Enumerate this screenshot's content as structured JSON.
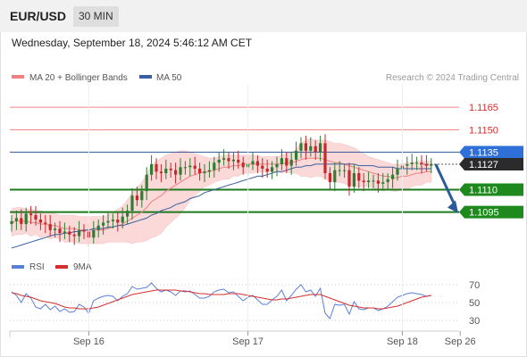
{
  "header": {
    "pair": "EUR/USD",
    "timeframe": "30 MIN",
    "timestamp": "Wednesday, September 18, 2024 5:46:12 AM CET"
  },
  "colors": {
    "ma20": "#f08080",
    "ma50": "#3a5fa0",
    "band": "#fbd9d9",
    "up": "#2e7d32",
    "down": "#c62828",
    "support": "#1e7a1e",
    "resistance": "#f08080",
    "level_blue": "#3a5fa0",
    "current": "#2b2b2b",
    "arrow": "#2a5a9a",
    "rsi": "#5b7fd9",
    "rsi_ma": "#d32f2f"
  },
  "legend": {
    "ma20_label": "MA 20 + Bollinger Bands",
    "ma50_label": "MA 50",
    "source": "Research © 2024 Trading Central"
  },
  "rsi_legend": {
    "rsi_label": "RSI",
    "ma_label": "9MA"
  },
  "chart_data": {
    "type": "candlestick",
    "ylim": [
      1.1065,
      1.118
    ],
    "levels": [
      {
        "price": 1.1165,
        "label": "1.1165",
        "kind": "resistance"
      },
      {
        "price": 1.115,
        "label": "1.1150",
        "kind": "resistance"
      },
      {
        "price": 1.1135,
        "label": "1.1135",
        "kind": "pivot"
      },
      {
        "price": 1.1127,
        "label": "1.1127",
        "kind": "current"
      },
      {
        "price": 1.111,
        "label": "1.1110",
        "kind": "support"
      },
      {
        "price": 1.1095,
        "label": "1.1095",
        "kind": "support"
      }
    ],
    "close": [
      1.1089,
      1.1091,
      1.1087,
      1.1094,
      1.1093,
      1.109,
      1.1088,
      1.1087,
      1.1083,
      1.1084,
      1.1081,
      1.1082,
      1.108,
      1.1079,
      1.1083,
      1.1082,
      1.1078,
      1.1083,
      1.1086,
      1.1088,
      1.1089,
      1.109,
      1.1088,
      1.1092,
      1.1096,
      1.1106,
      1.1103,
      1.1109,
      1.112,
      1.1127,
      1.1122,
      1.1121,
      1.1124,
      1.1123,
      1.112,
      1.1125,
      1.1125,
      1.1126,
      1.1124,
      1.1121,
      1.1122,
      1.1123,
      1.1128,
      1.113,
      1.1131,
      1.1129,
      1.113,
      1.1128,
      1.1125,
      1.1127,
      1.1129,
      1.1126,
      1.1124,
      1.1122,
      1.1125,
      1.1127,
      1.1131,
      1.1126,
      1.113,
      1.1136,
      1.1141,
      1.1136,
      1.1139,
      1.1135,
      1.1141,
      1.1121,
      1.1115,
      1.1123,
      1.1123,
      1.1123,
      1.1112,
      1.1121,
      1.1116,
      1.1115,
      1.1116,
      1.1116,
      1.1114,
      1.1115,
      1.1117,
      1.112,
      1.1124,
      1.1126,
      1.1127,
      1.1128,
      1.1128,
      1.1127,
      1.1126,
      1.1127
    ],
    "ma20": [
      1.1088,
      1.1089,
      1.1089,
      1.1089,
      1.1088,
      1.1088,
      1.1087,
      1.1087,
      1.1086,
      1.1086,
      1.1085,
      1.1084,
      1.1084,
      1.1084,
      1.1083,
      1.1083,
      1.1083,
      1.1083,
      1.1083,
      1.1083,
      1.1084,
      1.1085,
      1.1086,
      1.1087,
      1.1089,
      1.1091,
      1.1093,
      1.1095,
      1.1098,
      1.1102,
      1.1104,
      1.1106,
      1.1109,
      1.1111,
      1.1113,
      1.1115,
      1.1117,
      1.1119,
      1.112,
      1.1121,
      1.1122,
      1.1122,
      1.1123,
      1.1124,
      1.1125,
      1.1125,
      1.1126,
      1.1126,
      1.1127,
      1.1127,
      1.1127,
      1.1127,
      1.1127,
      1.1127,
      1.1127,
      1.1127,
      1.1127,
      1.1128,
      1.1128,
      1.1129,
      1.113,
      1.1131,
      1.1131,
      1.1131,
      1.1131,
      1.113,
      1.1129,
      1.1128,
      1.1128,
      1.1127,
      1.1126,
      1.1125,
      1.1124,
      1.1123,
      1.1122,
      1.1121,
      1.112,
      1.1119,
      1.1119,
      1.1118,
      1.1118,
      1.1119,
      1.1119,
      1.112,
      1.1121,
      1.1121,
      1.1122,
      1.1122
    ],
    "upper_band": [
      1.1097,
      1.1098,
      1.1098,
      1.1097,
      1.1097,
      1.1096,
      1.1096,
      1.1095,
      1.1095,
      1.1094,
      1.1093,
      1.1093,
      1.1093,
      1.1093,
      1.1092,
      1.1092,
      1.1092,
      1.1092,
      1.1092,
      1.1092,
      1.1093,
      1.1095,
      1.1097,
      1.1099,
      1.1103,
      1.1108,
      1.1111,
      1.1115,
      1.112,
      1.1126,
      1.1129,
      1.1131,
      1.1133,
      1.1134,
      1.1135,
      1.1136,
      1.1136,
      1.1135,
      1.1134,
      1.1133,
      1.1132,
      1.1131,
      1.1131,
      1.1132,
      1.1133,
      1.1133,
      1.1133,
      1.1133,
      1.1133,
      1.1133,
      1.1133,
      1.1132,
      1.1132,
      1.1132,
      1.1132,
      1.1132,
      1.1133,
      1.1134,
      1.1135,
      1.1137,
      1.1141,
      1.1143,
      1.1144,
      1.1143,
      1.1143,
      1.1143,
      1.1142,
      1.1141,
      1.1141,
      1.114,
      1.1139,
      1.1138,
      1.1136,
      1.1134,
      1.1132,
      1.1131,
      1.113,
      1.1129,
      1.1128,
      1.1127,
      1.1127,
      1.1127,
      1.1128,
      1.1128,
      1.1129,
      1.1129,
      1.1129,
      1.1129
    ],
    "lower_band": [
      1.1079,
      1.108,
      1.108,
      1.1081,
      1.1079,
      1.108,
      1.1078,
      1.1079,
      1.1077,
      1.1078,
      1.1077,
      1.1075,
      1.1075,
      1.1075,
      1.1074,
      1.1074,
      1.1074,
      1.1074,
      1.1074,
      1.1074,
      1.1075,
      1.1075,
      1.1075,
      1.1075,
      1.1075,
      1.1074,
      1.1075,
      1.1075,
      1.1076,
      1.1078,
      1.1079,
      1.1081,
      1.1085,
      1.1088,
      1.1091,
      1.1094,
      1.1098,
      1.1103,
      1.1106,
      1.1109,
      1.1112,
      1.1113,
      1.1115,
      1.1116,
      1.1117,
      1.1117,
      1.1119,
      1.1119,
      1.1121,
      1.1121,
      1.1121,
      1.1122,
      1.1122,
      1.1122,
      1.1122,
      1.1122,
      1.1121,
      1.1122,
      1.1121,
      1.1121,
      1.1119,
      1.1119,
      1.1118,
      1.1119,
      1.1119,
      1.1117,
      1.1116,
      1.1115,
      1.1115,
      1.1114,
      1.1113,
      1.1112,
      1.1112,
      1.1112,
      1.1112,
      1.1111,
      1.111,
      1.1109,
      1.111,
      1.1109,
      1.1109,
      1.1111,
      1.111,
      1.1112,
      1.1113,
      1.1113,
      1.1115,
      1.1115
    ],
    "ma50": [
      1.1071,
      1.1072,
      1.1073,
      1.1074,
      1.1075,
      1.1076,
      1.1077,
      1.1078,
      1.1079,
      1.108,
      1.108,
      1.1081,
      1.1081,
      1.1082,
      1.1082,
      1.1083,
      1.1083,
      1.1084,
      1.1084,
      1.1084,
      1.1085,
      1.1085,
      1.1086,
      1.1086,
      1.1087,
      1.1088,
      1.1089,
      1.109,
      1.1091,
      1.1093,
      1.1094,
      1.1096,
      1.1097,
      1.1098,
      1.11,
      1.1101,
      1.1102,
      1.1104,
      1.1105,
      1.1106,
      1.1108,
      1.1109,
      1.111,
      1.1111,
      1.1112,
      1.1113,
      1.1114,
      1.1115,
      1.1116,
      1.1117,
      1.1118,
      1.1119,
      1.1119,
      1.112,
      1.1121,
      1.1122,
      1.1122,
      1.1123,
      1.1124,
      1.1125,
      1.1125,
      1.1126,
      1.1126,
      1.1127,
      1.1127,
      1.1127,
      1.1127,
      1.1127,
      1.1127,
      1.1127,
      1.1127,
      1.1127,
      1.1126,
      1.1126,
      1.1126,
      1.1126,
      1.1125,
      1.1125,
      1.1125,
      1.1125,
      1.1124,
      1.1124,
      1.1124,
      1.1124,
      1.1124,
      1.1124,
      1.1124,
      1.1124
    ],
    "x_tick_labels": [
      {
        "index": 16,
        "label": "Sep 16"
      },
      {
        "index": 49,
        "label": "Sep 17"
      },
      {
        "index": 81,
        "label": "Sep 18"
      },
      {
        "index": 93,
        "label": "Sep 26"
      }
    ],
    "forecast": {
      "from": 1.1127,
      "to": 1.1095
    },
    "rsi_axis": {
      "ylim": [
        20,
        80
      ],
      "ticks": [
        70,
        50,
        30
      ]
    },
    "rsi": [
      62,
      58,
      50,
      60,
      55,
      45,
      43,
      48,
      42,
      46,
      40,
      43,
      39,
      40,
      48,
      45,
      38,
      52,
      55,
      57,
      58,
      57,
      52,
      57,
      60,
      68,
      65,
      66,
      67,
      72,
      66,
      62,
      64,
      62,
      58,
      63,
      62,
      63,
      59,
      55,
      55,
      57,
      62,
      64,
      65,
      61,
      62,
      57,
      52,
      56,
      58,
      53,
      48,
      48,
      53,
      57,
      64,
      52,
      58,
      65,
      70,
      62,
      64,
      57,
      66,
      38,
      32,
      48,
      47,
      48,
      37,
      51,
      43,
      42,
      44,
      44,
      41,
      43,
      46,
      51,
      56,
      58,
      60,
      61,
      60,
      59,
      57,
      58
    ],
    "rsi_ma": [
      61,
      60,
      58,
      57,
      56,
      54,
      52,
      51,
      50,
      49,
      47,
      45,
      44,
      44,
      43,
      43,
      43,
      44,
      45,
      47,
      49,
      51,
      53,
      55,
      57,
      59,
      60,
      61,
      62,
      63,
      64,
      64,
      64,
      64,
      64,
      63,
      63,
      62,
      61,
      60,
      60,
      59,
      59,
      59,
      59,
      60,
      60,
      60,
      59,
      58,
      57,
      56,
      55,
      54,
      53,
      53,
      54,
      54,
      55,
      56,
      57,
      58,
      59,
      59,
      59,
      57,
      55,
      53,
      51,
      49,
      47,
      46,
      45,
      44,
      44,
      44,
      43,
      43,
      44,
      45,
      46,
      48,
      50,
      52,
      54,
      56,
      57,
      58
    ]
  }
}
